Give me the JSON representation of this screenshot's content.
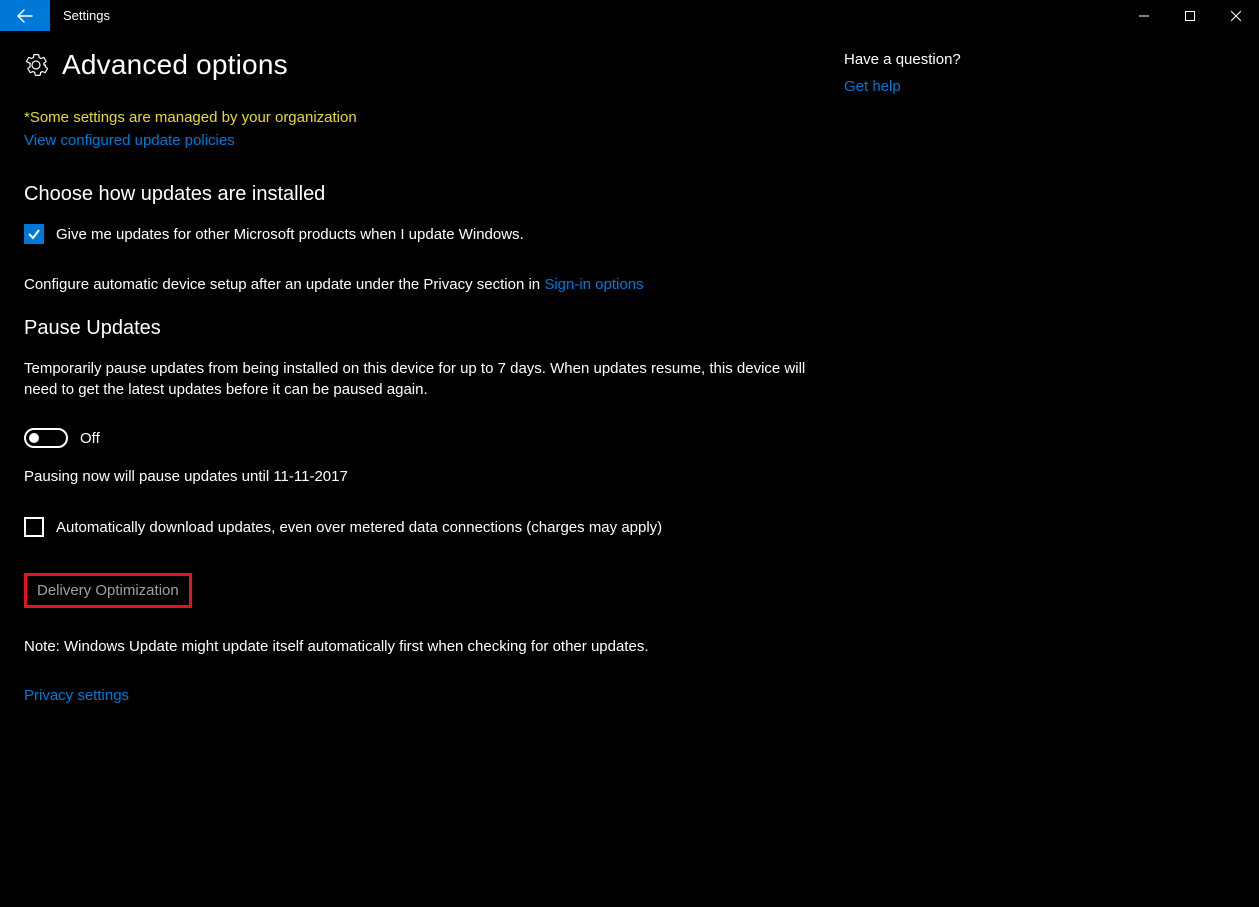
{
  "titlebar": {
    "title": "Settings"
  },
  "header": {
    "title": "Advanced options"
  },
  "notice": {
    "org_text": "*Some settings are managed by your organization",
    "policies_link": "View configured update policies"
  },
  "section1": {
    "heading": "Choose how updates are installed",
    "checkbox_label": "Give me updates for other Microsoft products when I update Windows.",
    "config_text": "Configure automatic device setup after an update under the Privacy section in ",
    "signin_link": "Sign-in options"
  },
  "section2": {
    "heading": "Pause Updates",
    "description": "Temporarily pause updates from being installed on this device for up to 7 days. When updates resume, this device will need to get the latest updates before it can be paused again.",
    "toggle_state": "Off",
    "pause_note": "Pausing now will pause updates until 11-11-2017",
    "metered_label": "Automatically download updates, even over metered data connections (charges may apply)"
  },
  "delivery": {
    "link": "Delivery Optimization"
  },
  "note": {
    "text": "Note: Windows Update might update itself automatically first when checking for other updates."
  },
  "privacy": {
    "link": "Privacy settings"
  },
  "side": {
    "heading": "Have a question?",
    "help_link": "Get help"
  }
}
